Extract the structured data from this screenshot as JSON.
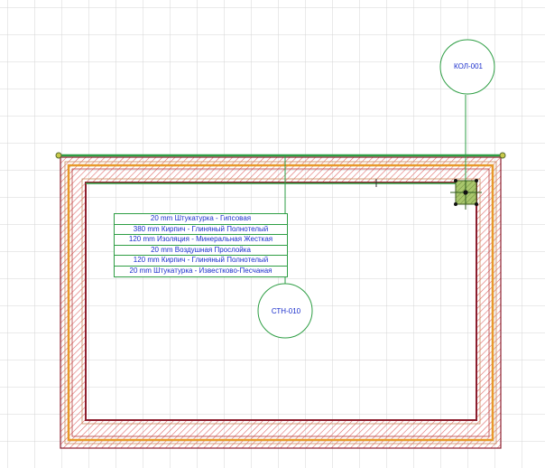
{
  "column_tag": {
    "label": "КОЛ-001"
  },
  "wall_tag": {
    "label": "СТН-010"
  },
  "wall_layers": [
    {
      "label": "20 mm  Штукатурка - Гипсовая"
    },
    {
      "label": "380 mm  Кирпич - Глиняный Полнотелый"
    },
    {
      "label": "120 mm  Изоляция - Минеральная Жесткая"
    },
    {
      "label": "20 mm  Воздушная Прослойка"
    },
    {
      "label": "120 mm  Кирпич - Глиняный Полнотелый"
    },
    {
      "label": "20 mm  Штукатурка - Известково-Песчаная"
    }
  ],
  "colors": {
    "grid": "#d4d4d4",
    "hatch": "#e06a6a",
    "wall_outline": "#8c1f2e",
    "insulation": "#e79a2a",
    "reference_line": "#2e9e44",
    "label_text": "#1a2ecc"
  }
}
